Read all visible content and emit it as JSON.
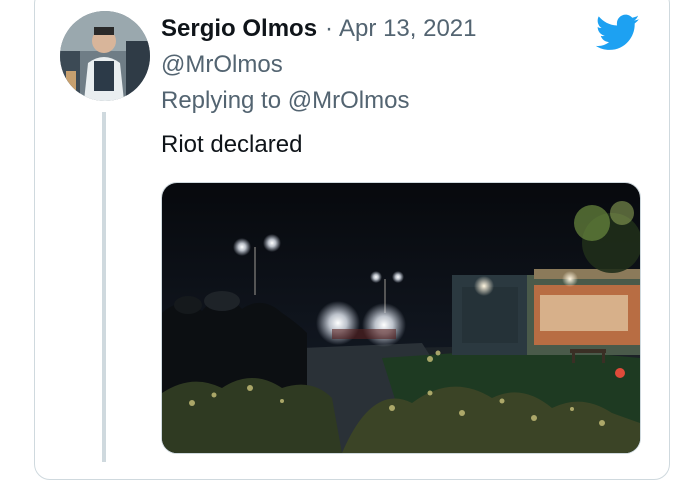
{
  "tweet": {
    "author_name": "Sergio Olmos",
    "separator": "·",
    "date": "Apr 13, 2021",
    "handle": "@MrOlmos",
    "replying_prefix": "Replying to",
    "replying_to": "@MrOlmos",
    "text": "Riot declared"
  },
  "icons": {
    "brand": "twitter-bird-icon",
    "brand_color": "#1da1f2"
  },
  "media": {
    "description_kind": "night-photo"
  }
}
